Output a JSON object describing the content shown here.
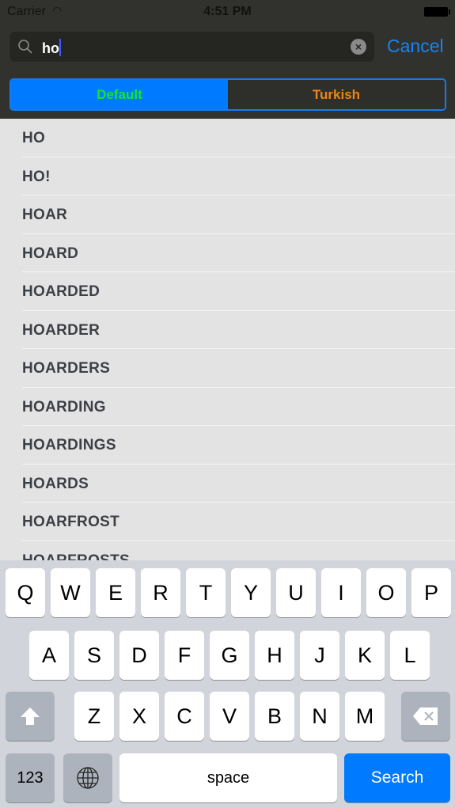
{
  "status": {
    "carrier": "Carrier",
    "time": "4:51 PM"
  },
  "search": {
    "query": "ho",
    "cancel_label": "Cancel"
  },
  "segments": [
    {
      "label": "Default",
      "selected": true
    },
    {
      "label": "Turkish",
      "selected": false
    }
  ],
  "colors": {
    "accent": "#007aff",
    "default_text": "#11e63a",
    "turkish_text": "#f08412"
  },
  "results": [
    "HO",
    "HO!",
    "HOAR",
    "HOARD",
    "HOARDED",
    "HOARDER",
    "HOARDERS",
    "HOARDING",
    "HOARDINGS",
    "HOARDS",
    "HOARFROST",
    "HOARFROSTS"
  ],
  "keyboard": {
    "row1": [
      "Q",
      "W",
      "E",
      "R",
      "T",
      "Y",
      "U",
      "I",
      "O",
      "P"
    ],
    "row2": [
      "A",
      "S",
      "D",
      "F",
      "G",
      "H",
      "J",
      "K",
      "L"
    ],
    "row3": [
      "Z",
      "X",
      "C",
      "V",
      "B",
      "N",
      "M"
    ],
    "numbers": "123",
    "space": "space",
    "search": "Search"
  }
}
